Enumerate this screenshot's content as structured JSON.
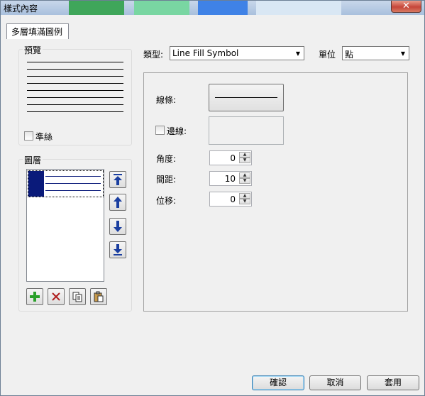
{
  "window": {
    "title": "樣式內容",
    "close_glyph": "✕"
  },
  "tabs": [
    {
      "label": "多層填滿圖例"
    }
  ],
  "preview": {
    "label": "預覽",
    "guideline_label": "準絲",
    "guideline_checked": false
  },
  "layers": {
    "label": "圖層",
    "buttons": [
      "move-top",
      "move-up",
      "move-down",
      "move-bottom"
    ],
    "tools": [
      "add",
      "delete",
      "copy",
      "paste"
    ]
  },
  "type": {
    "label": "類型:",
    "value": "Line Fill Symbol"
  },
  "unit": {
    "label": "單位",
    "value": "點"
  },
  "props": {
    "line_label": "線條:",
    "outline_label": "邊線:",
    "outline_checked": false,
    "angle_label": "角度:",
    "angle_value": "0",
    "spacing_label": "間距:",
    "spacing_value": "10",
    "offset_label": "位移:",
    "offset_value": "0"
  },
  "footer": {
    "ok": "確認",
    "cancel": "取消",
    "apply": "套用"
  },
  "colors": {
    "accent": "#0a1a7a",
    "arrow": "#1a3ea0",
    "add": "#2aa02a",
    "delete": "#b02020"
  }
}
